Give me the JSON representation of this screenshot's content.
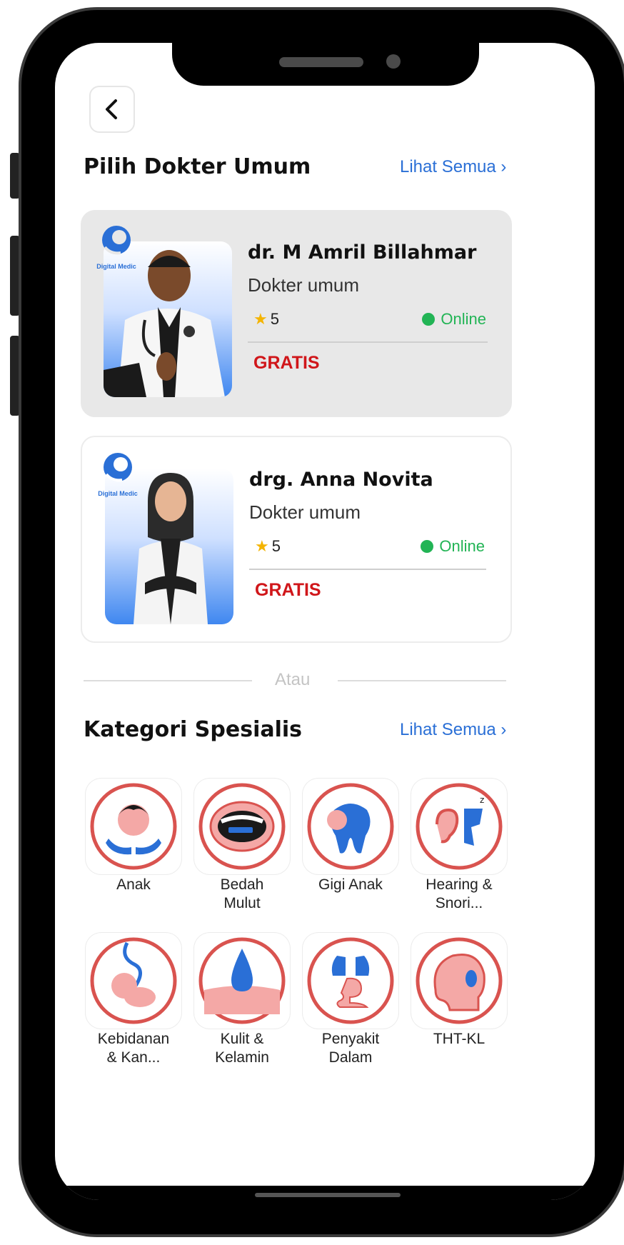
{
  "header": {
    "back_icon": "chevron-left-icon"
  },
  "doctors_section": {
    "title": "Pilih Dokter Umum",
    "see_all": "Lihat Semua ›"
  },
  "doctors": [
    {
      "name": "dr. M Amril Billahmar",
      "specialty": "Dokter umum",
      "rating": "5",
      "status": "Online",
      "price": "GRATIS",
      "logo_text": "Digital Medic"
    },
    {
      "name": "drg. Anna Novita",
      "specialty": "Dokter umum",
      "rating": "5",
      "status": "Online",
      "price": "GRATIS",
      "logo_text": "Digital Medic"
    }
  ],
  "divider_text": "Atau",
  "categories_section": {
    "title": "Kategori Spesialis",
    "see_all": "Lihat Semua ›"
  },
  "categories": [
    {
      "label": "Anak",
      "label2": ""
    },
    {
      "label": "Bedah",
      "label2": "Mulut"
    },
    {
      "label": "Gigi Anak",
      "label2": ""
    },
    {
      "label": "Hearing &",
      "label2": "Snori..."
    },
    {
      "label": "Kebidanan",
      "label2": "& Kan..."
    },
    {
      "label": "Kulit &",
      "label2": "Kelamin"
    },
    {
      "label": "Penyakit",
      "label2": "Dalam"
    },
    {
      "label": "THT-KL",
      "label2": ""
    }
  ],
  "colors": {
    "accent": "#2a6fd6",
    "price": "#d0161a",
    "online": "#22b455",
    "icon_ring": "#d9534f",
    "icon_fill": "#f4a8a6"
  }
}
